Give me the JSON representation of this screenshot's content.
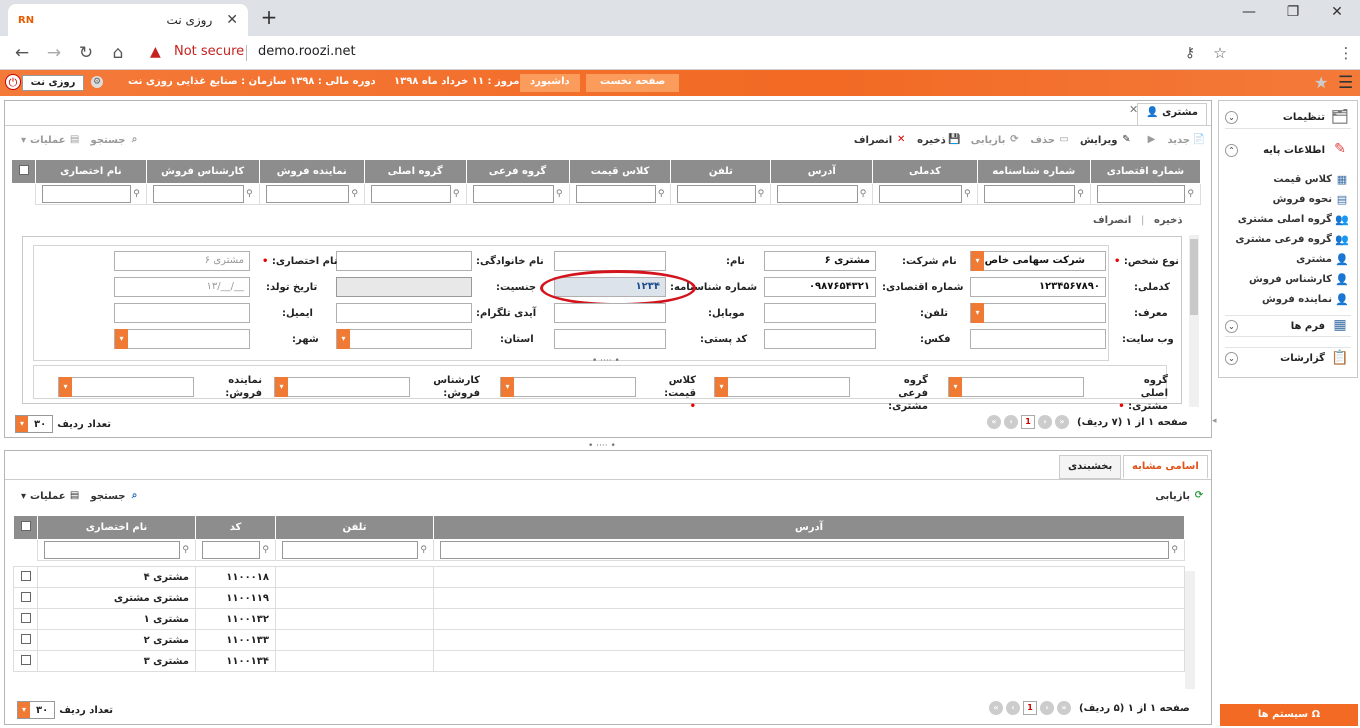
{
  "browser": {
    "tab_title": "روزی نت",
    "tab_favicon": "RN",
    "not_secure": "Not secure",
    "url": "demo.roozi.net"
  },
  "appbar": {
    "brand": "روزی نت",
    "org_label": "سازمان : صنایع غذایی روزی نت",
    "fiscal_label": "دوره مالی : ۱۳۹۸",
    "today_label": "امروز : ۱۱ خرداد ماه ۱۳۹۸",
    "dashboard_btn": "داشبورد",
    "home_btn": "صفحه نخست"
  },
  "main_tab": {
    "label": "مشتری"
  },
  "toolbar": {
    "new": "جدید",
    "save": "ذخیره",
    "edit": "ویرایش",
    "delete": "حذف",
    "refresh": "بازیابی",
    "save2": "ذخیره",
    "cancel": "انصراف",
    "search": "جستجو",
    "operations": "عملیات"
  },
  "customer_table": {
    "columns": [
      "نام اختصاری",
      "کارشناس فروش",
      "نماینده فروش",
      "گروه اصلی",
      "گروه فرعی",
      "کلاس قیمت",
      "تلفن",
      "آدرس",
      "کدملی",
      "شماره شناسنامه",
      "شماره اقتصادی"
    ]
  },
  "form_actions": {
    "save": "ذخیره",
    "cancel": "انصراف"
  },
  "form": {
    "person_type_label": "نوع شخص:",
    "person_type_value": "شرکت سهامی خاص",
    "company_name_label": "نام شرکت:",
    "company_name_value": "مشتری ۶",
    "first_name_label": "نام:",
    "last_name_label": "نام خانوادگی:",
    "short_name_label": "نام اختصاری:",
    "short_name_value": "مشتری ۶",
    "national_id_label": "کدملی:",
    "national_id_value": "۱۲۳۴۵۶۷۸۹۰",
    "economic_no_label": "شماره اقتصادی:",
    "economic_no_value": "۰۹۸۷۶۵۴۳۲۱",
    "id_no_label": "شماره شناسنامه:",
    "id_no_value": "۱۲۳۴",
    "gender_label": "جنسیت:",
    "birth_date_label": "تاریخ تولد:",
    "birth_date_placeholder": "__/__/۱۳",
    "referrer_label": "معرف:",
    "phone_label": "تلفن:",
    "mobile_label": "موبایل:",
    "telegram_label": "آیدی تلگرام:",
    "email_label": "ایمیل:",
    "website_label": "وب سایت:",
    "fax_label": "فکس:",
    "postal_code_label": "کد پستی:",
    "province_label": "استان:",
    "city_label": "شهر:",
    "main_group_label": "گروه اصلی مشتری:",
    "sub_group_label": "گروه فرعی مشتری:",
    "price_class_label": "کلاس قیمت:",
    "sales_expert_label": "کارشناس فروش:",
    "sales_rep_label": "نماینده فروش:"
  },
  "pager_top": {
    "text": "صفحه ۱ از ۱ (۷ ردیف)",
    "page": "1",
    "rows_label": "تعداد ردیف",
    "rows_value": "۳۰"
  },
  "lower": {
    "tab_similar": "اسامی مشابه",
    "tab_segment": "بخشبندی",
    "refresh": "بازیابی",
    "search": "جستجو",
    "operations": "عملیات",
    "columns": [
      "نام اختصاری",
      "کد",
      "تلفن",
      "آدرس"
    ],
    "rows": [
      {
        "name": "مشتری ۴",
        "code": "۱۱۰۰۰۱۸"
      },
      {
        "name": "مشتری مشتری",
        "code": "۱۱۰۰۱۱۹"
      },
      {
        "name": "مشتری ۱",
        "code": "۱۱۰۰۱۳۲"
      },
      {
        "name": "مشتری ۲",
        "code": "۱۱۰۰۱۳۳"
      },
      {
        "name": "مشتری ۳",
        "code": "۱۱۰۰۱۳۴"
      }
    ]
  },
  "pager_bottom": {
    "text": "صفحه ۱ از ۱ (۵ ردیف)",
    "page": "1",
    "rows_label": "تعداد ردیف",
    "rows_value": "۳۰"
  },
  "sidebar": {
    "settings": "تنظیمات",
    "base_info": "اطلاعات پایه",
    "items": [
      "کلاس قیمت",
      "نحوه فروش",
      "گروه اصلی مشتری",
      "گروه فرعی مشتری",
      "مشتری",
      "کارشناس فروش",
      "نماینده فروش"
    ],
    "forms": "فرم ها",
    "reports": "گزارشات",
    "systems": "سیستم ها"
  }
}
